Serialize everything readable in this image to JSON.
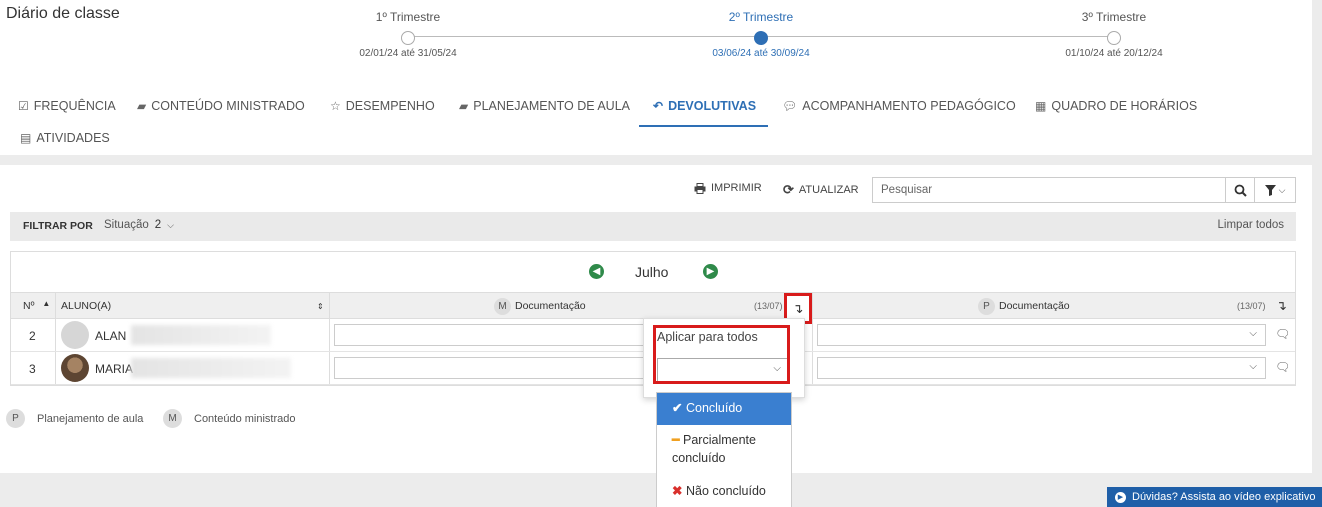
{
  "page": {
    "title": "Diário de classe"
  },
  "terms": [
    {
      "name": "1º Trimestre",
      "range": "02/01/24 até 31/05/24",
      "active": false
    },
    {
      "name": "2º Trimestre",
      "range": "03/06/24 até 30/09/24",
      "active": true
    },
    {
      "name": "3º Trimestre",
      "range": "01/10/24 até 20/12/24",
      "active": false
    }
  ],
  "tabs": [
    {
      "label": "FREQUÊNCIA",
      "icon": "check-square-icon"
    },
    {
      "label": "CONTEÚDO MINISTRADO",
      "icon": "book-icon"
    },
    {
      "label": "DESEMPENHO",
      "icon": "star-icon"
    },
    {
      "label": "PLANEJAMENTO DE AULA",
      "icon": "book-icon"
    },
    {
      "label": "DEVOLUTIVAS",
      "icon": "reply-icon",
      "active": true
    },
    {
      "label": "ACOMPANHAMENTO PEDAGÓGICO",
      "icon": "comment-icon"
    },
    {
      "label": "QUADRO DE HORÁRIOS",
      "icon": "calendar-icon"
    },
    {
      "label": "ATIVIDADES",
      "icon": "file-icon"
    }
  ],
  "toolbar": {
    "print_label": "IMPRIMIR",
    "refresh_label": "ATUALIZAR",
    "search_placeholder": "Pesquisar"
  },
  "filter": {
    "label": "FILTRAR POR",
    "situation_label": "Situação",
    "situation_count": "2",
    "clear_label": "Limpar todos"
  },
  "grid": {
    "month": "Julho",
    "headers": {
      "number": "Nº",
      "student": "ALUNO(A)",
      "col1_badge": "M",
      "col1_label": "Documentação",
      "col1_count": "(13/07)",
      "col2_badge": "P",
      "col2_label": "Documentação",
      "col2_count": "(13/07)"
    },
    "rows": [
      {
        "number": "2",
        "first_name": "ALAN"
      },
      {
        "number": "3",
        "first_name": "MARIA"
      }
    ]
  },
  "legend": [
    {
      "badge": "P",
      "label": "Planejamento de aula"
    },
    {
      "badge": "M",
      "label": "Conteúdo ministrado"
    }
  ],
  "apply_popup": {
    "title": "Aplicar para todos",
    "options": [
      {
        "icon": "check-icon",
        "label": "Concluído",
        "color": "#ffffff",
        "selected": true
      },
      {
        "icon": "minus-icon",
        "label": "Parcialmente concluído",
        "color": "#f0a020",
        "selected": false
      },
      {
        "icon": "x-icon",
        "label": "Não concluído",
        "color": "#d9302c",
        "selected": false
      }
    ]
  },
  "help": {
    "label": "Dúvidas? Assista ao vídeo explicativo"
  },
  "colors": {
    "accent": "#2e6fb5",
    "highlight": "#d81b1b",
    "nav_green": "#2f8a4a"
  }
}
